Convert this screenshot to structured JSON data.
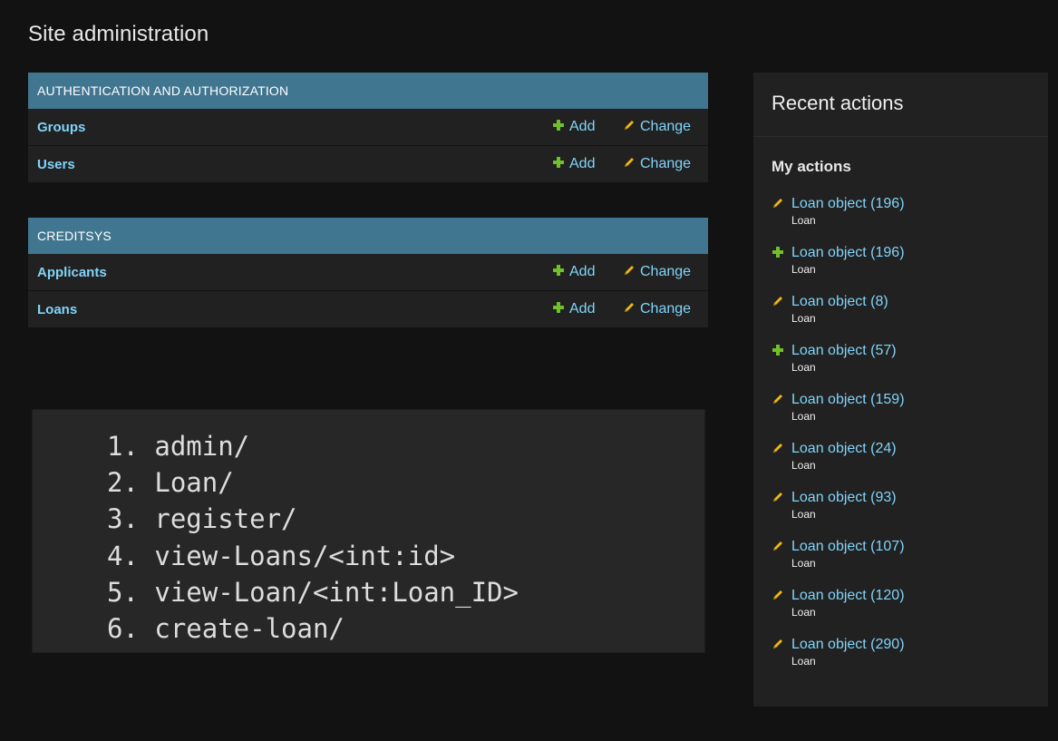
{
  "page_title": "Site administration",
  "colors": {
    "background": "#121212",
    "module_header": "#417690",
    "link": "#81d4fa",
    "add_icon": "#70bf2b",
    "change_icon": "#efb80b"
  },
  "modules": [
    {
      "caption": "Authentication and Authorization",
      "models": [
        {
          "name": "Groups",
          "add_label": "Add",
          "change_label": "Change"
        },
        {
          "name": "Users",
          "add_label": "Add",
          "change_label": "Change"
        }
      ]
    },
    {
      "caption": "Creditsys",
      "models": [
        {
          "name": "Applicants",
          "add_label": "Add",
          "change_label": "Change"
        },
        {
          "name": "Loans",
          "add_label": "Add",
          "change_label": "Change"
        }
      ]
    }
  ],
  "url_list": [
    "1. admin/",
    "2. Loan/",
    "3. register/",
    "4. view-Loans/<int:id>",
    "5. view-Loan/<int:Loan_ID>",
    "6. create-loan/"
  ],
  "recent_actions": {
    "title": "Recent actions",
    "subtitle": "My actions",
    "items": [
      {
        "icon": "pencil-icon",
        "label": "Loan object (196)",
        "type": "Loan"
      },
      {
        "icon": "plus-icon",
        "label": "Loan object (196)",
        "type": "Loan"
      },
      {
        "icon": "pencil-icon",
        "label": "Loan object (8)",
        "type": "Loan"
      },
      {
        "icon": "plus-icon",
        "label": "Loan object (57)",
        "type": "Loan"
      },
      {
        "icon": "pencil-icon",
        "label": "Loan object (159)",
        "type": "Loan"
      },
      {
        "icon": "pencil-icon",
        "label": "Loan object (24)",
        "type": "Loan"
      },
      {
        "icon": "pencil-icon",
        "label": "Loan object (93)",
        "type": "Loan"
      },
      {
        "icon": "pencil-icon",
        "label": "Loan object (107)",
        "type": "Loan"
      },
      {
        "icon": "pencil-icon",
        "label": "Loan object (120)",
        "type": "Loan"
      },
      {
        "icon": "pencil-icon",
        "label": "Loan object (290)",
        "type": "Loan"
      }
    ]
  }
}
